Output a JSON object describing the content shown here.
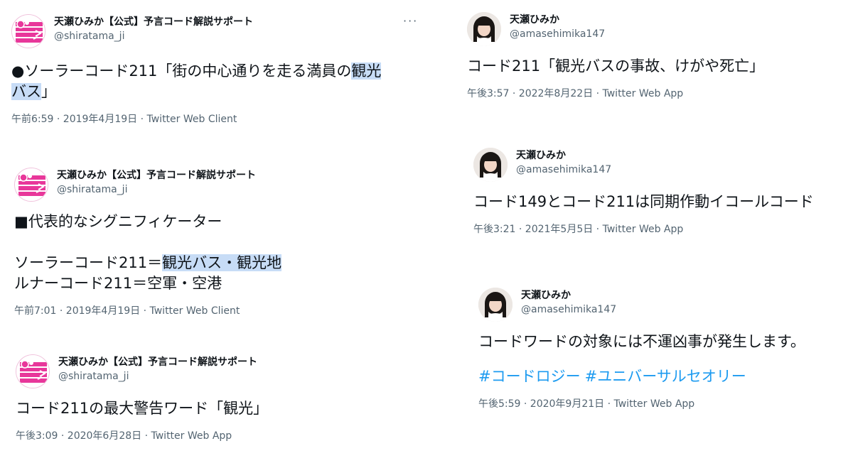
{
  "tweets": [
    {
      "name": "天瀬ひみか【公式】予言コード解説サポート",
      "handle": "@shiratama_ji",
      "body_pre": "●ソーラーコード211「街の中心通りを走る満員の",
      "body_hl1": "観光",
      "body_mid": "\n",
      "body_hl2": "バス",
      "body_post": "」",
      "meta": "午前6:59 · 2019年4月19日 · Twitter Web Client",
      "more": "···"
    },
    {
      "name": "天瀬ひみか【公式】予言コード解説サポート",
      "handle": "@shiratama_ji",
      "line1": "■代表的なシグニフィケーター",
      "line2_pre": "ソーラーコード211＝",
      "line2_hl": "観光バス・観光地",
      "line3": "ルナーコード211＝空軍・空港",
      "meta": "午前7:01 · 2019年4月19日 · Twitter Web Client"
    },
    {
      "name": "天瀬ひみか【公式】予言コード解説サポート",
      "handle": "@shiratama_ji",
      "body": "コード211の最大警告ワード「観光」",
      "meta": "午後3:09 · 2020年6月28日 · Twitter Web App"
    },
    {
      "name": "天瀬ひみか",
      "handle": "@amasehimika147",
      "body": "コード211「観光バスの事故、けがや死亡」",
      "meta": "午後3:57 · 2022年8月22日 · Twitter Web App"
    },
    {
      "name": "天瀬ひみか",
      "handle": "@amasehimika147",
      "body": "コード149とコード211は同期作動イコールコード",
      "meta": "午後3:21 · 2021年5月5日 · Twitter Web App"
    },
    {
      "name": "天瀬ひみか",
      "handle": "@amasehimika147",
      "body": "コードワードの対象には不運凶事が発生します。",
      "hashtags": [
        "#コードロジー",
        "#ユニバーサルセオリー"
      ],
      "meta": "午後5:59 · 2020年9月21日 · Twitter Web App"
    }
  ],
  "colors": {
    "text": "#0f1419",
    "secondary": "#536471",
    "highlight": "#c7dcf6",
    "hashtag": "#1d9bf0",
    "logo_pink": "#e8379a"
  }
}
